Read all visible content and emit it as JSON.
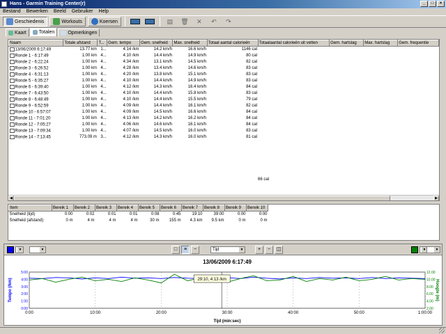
{
  "window": {
    "title": "Hans - Garmin Training Center(r)"
  },
  "menu": [
    "Bestand",
    "Bewerken",
    "Beeld",
    "Gebruiker",
    "Help"
  ],
  "toolbar": {
    "buttons": [
      "Geschiedenis",
      "Workouts",
      "Koersen"
    ]
  },
  "tabs": [
    "Kaart",
    "Totalen",
    "Opmerkingen"
  ],
  "laps": {
    "columns": [
      "Naam",
      "Totale afstand",
      "T...",
      "Gem. tempo",
      "Gem. snelheid",
      "Max. snelheid",
      "Totaal aantal calorieën",
      "Totaalaantal calorieën uit vetten",
      "Gem. hartslag",
      "Max. hartslag",
      "Gem. frequentie"
    ],
    "rows": [
      [
        "13/06/2009 6:17:49",
        "13.77 km",
        "1...",
        "4:14 /km",
        "14.2 km/h",
        "16.6 km/h",
        "1146 cal",
        "",
        "",
        "",
        ""
      ],
      [
        "Ronde 1 - 6:17:49",
        "1.00 km",
        "4...",
        "4:10 /km",
        "14.4 km/h",
        "14.9 km/h",
        "80 cal",
        "",
        "",
        "",
        ""
      ],
      [
        "Ronde 2 - 6:22:24",
        "1.00 km",
        "4...",
        "4:34 /km",
        "13.1 km/h",
        "14.5 km/h",
        "82 cal",
        "",
        "",
        "",
        ""
      ],
      [
        "Ronde 3 - 6:26:52",
        "1.00 km",
        "4...",
        "4:28 /km",
        "13.4 km/h",
        "14.6 km/h",
        "83 cal",
        "",
        "",
        "",
        ""
      ],
      [
        "Ronde 4 - 6:31:13",
        "1.00 km",
        "4...",
        "4:20 /km",
        "13.8 km/h",
        "15.1 km/h",
        "83 cal",
        "",
        "",
        "",
        ""
      ],
      [
        "Ronde 5 - 6:35:27",
        "1.00 km",
        "4...",
        "4:10 /km",
        "14.4 km/h",
        "14.9 km/h",
        "83 cal",
        "",
        "",
        "",
        ""
      ],
      [
        "Ronde 6 - 6:39:40",
        "1.00 km",
        "4...",
        "4:12 /km",
        "14.3 km/h",
        "16.4 km/h",
        "84 cal",
        "",
        "",
        "",
        ""
      ],
      [
        "Ronde 7 - 6:43:50",
        "1.00 km",
        "4...",
        "4:10 /km",
        "14.4 km/h",
        "15.8 km/h",
        "83 cal",
        "",
        "",
        "",
        ""
      ],
      [
        "Ronde 8 - 6:48:49",
        "1.00 km",
        "4...",
        "4:10 /km",
        "14.4 km/h",
        "15.5 km/h",
        "79 cal",
        "",
        "",
        "",
        ""
      ],
      [
        "Ronde 9 - 6:52:59",
        "1.00 km",
        "4...",
        "4:09 /km",
        "14.4 km/h",
        "16.1 km/h",
        "82 cal",
        "",
        "",
        "",
        ""
      ],
      [
        "Ronde 10 - 6:57:07",
        "1.00 km",
        "4...",
        "4:09 /km",
        "14.5 km/h",
        "16.6 km/h",
        "84 cal",
        "",
        "",
        "",
        ""
      ],
      [
        "Ronde 11 - 7:01:20",
        "1.00 km",
        "4...",
        "4:13 /km",
        "14.2 km/h",
        "16.2 km/h",
        "84 cal",
        "",
        "",
        "",
        ""
      ],
      [
        "Ronde 12 - 7:05:27",
        "1.00 km",
        "4...",
        "4:06 /km",
        "14.6 km/h",
        "16.1 km/h",
        "84 cal",
        "",
        "",
        "",
        ""
      ],
      [
        "Ronde 13 - 7:09:34",
        "1.00 km",
        "4...",
        "4:07 /km",
        "14.5 km/h",
        "16.0 km/h",
        "83 cal",
        "",
        "",
        "",
        ""
      ],
      [
        "Ronde 14 - 7:13:45",
        "773.09 m",
        "3...",
        "4:12 /km",
        "14.3 km/h",
        "16.0 km/h",
        "81 cal",
        "",
        "",
        "",
        ""
      ]
    ],
    "extra_value": "66 cal"
  },
  "zones": {
    "columns": [
      "Item",
      "Bereik 1",
      "Bereik 2",
      "Bereik 3",
      "Bereik 4",
      "Bereik 5",
      "Bereik 6",
      "Bereik 7",
      "Bereik 8",
      "Bereik 9",
      "Bereik 10"
    ],
    "rows": [
      [
        "Snelheid (tijd)",
        "0:00",
        "0:02",
        "0:01",
        "0:01",
        "0:08",
        "0:45",
        "19:10",
        "39:00",
        "0:00",
        "0:00"
      ],
      [
        "Snelheid (afstand)",
        "0 m",
        "4 m",
        "4 m",
        "4 m",
        "30 m",
        "155 m",
        "4.3 km",
        "9.5 km",
        "0 m",
        "0 m"
      ]
    ]
  },
  "chart_controls": {
    "left_color": "#0000ff",
    "x_axis_mode": "Tijd",
    "right_color": "#008000"
  },
  "chart_data": {
    "type": "line",
    "title": "13/06/2009 6:17:49",
    "xlabel": "Tijd (min:sec)",
    "ylabel": "Tempo (/km)",
    "y2label": "Hoogte (m)",
    "x_ticks": [
      "0:00",
      "10:00",
      "20:00",
      "30:00",
      "40:00",
      "50:00",
      "1:00:00"
    ],
    "y_ticks": [
      "0:00",
      "1:00",
      "2:00",
      "3:00",
      "4:00",
      "5:00"
    ],
    "y2_ticks": [
      "12.00",
      "10.00",
      "8.00",
      "6.00",
      "4.00",
      "2.00"
    ],
    "xlim": [
      0,
      60
    ],
    "tooltip": "29:10, 4:13 /km",
    "tooltip_x": 29.17,
    "series": [
      {
        "color": "#0000ff",
        "x": [
          0,
          2,
          4,
          6,
          8,
          10,
          12,
          14,
          16,
          18,
          20,
          22,
          24,
          26,
          28,
          30,
          32,
          34,
          36,
          38,
          40,
          42,
          44,
          46,
          48,
          50,
          52,
          54,
          56,
          58,
          60
        ],
        "values": [
          4.15,
          4.1,
          4.25,
          4.2,
          4.05,
          4.2,
          4.1,
          4.3,
          4.15,
          4.2,
          4.1,
          4.25,
          4.15,
          4.1,
          4.2,
          4.22,
          4.1,
          4.3,
          4.15,
          4.05,
          4.2,
          4.1,
          4.25,
          4.15,
          4.2,
          4.1,
          4.25,
          4.1,
          4.2,
          4.15,
          4.1
        ]
      },
      {
        "color": "#008000",
        "x": [
          0,
          2,
          4,
          6,
          8,
          10,
          12,
          14,
          16,
          18,
          20,
          22,
          24,
          26,
          28,
          30,
          32,
          34,
          36,
          38,
          40,
          42,
          44,
          46,
          48,
          50,
          52,
          54,
          56,
          58,
          60
        ],
        "values": [
          3.9,
          4.1,
          3.6,
          4.0,
          4.3,
          3.8,
          4.0,
          3.7,
          4.2,
          3.9,
          3.5,
          4.7,
          3.8,
          4.2,
          3.9,
          3.6,
          4.1,
          4.5,
          3.8,
          3.9,
          4.4,
          3.7,
          4.1,
          3.9,
          4.3,
          3.8,
          4.0,
          4.4,
          3.9,
          4.1,
          4.0
        ]
      }
    ]
  }
}
